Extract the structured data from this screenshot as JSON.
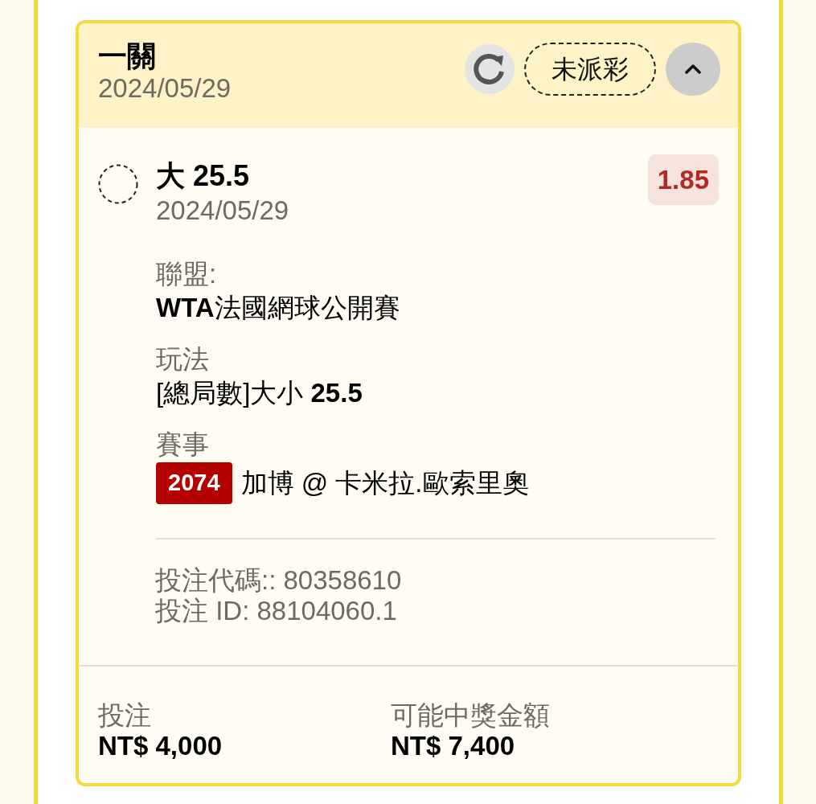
{
  "bet_card": {
    "header": {
      "title": "一關",
      "date": "2024/05/29",
      "status": "未派彩",
      "expanded": true
    },
    "selection": {
      "selected": false,
      "name": "大 25.5",
      "date": "2024/05/29",
      "odds": "1.85"
    },
    "details": [
      {
        "label": "聯盟:",
        "value": "**WTA**法國網球公開賽"
      },
      {
        "label": "玩法",
        "value": "[總局數]大小 **25.5**"
      },
      {
        "label": "賽事",
        "event_code": "2074",
        "value": "加博 @ 卡米拉.歐索里奧"
      }
    ],
    "bet_codes": [
      "投注代碼:: 80358610",
      "投注 ID: 88104060.1"
    ],
    "footer": [
      {
        "label": "投注",
        "value": "NT$ 4,000"
      },
      {
        "label": "可能中獎金額",
        "value": "NT$ 7,400"
      }
    ]
  }
}
